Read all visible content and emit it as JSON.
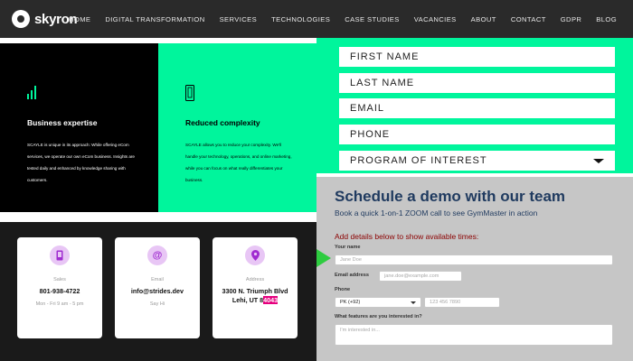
{
  "nav": {
    "logo_text": "skyron",
    "items": [
      "HOME",
      "DIGITAL TRANSFORMATION",
      "SERVICES",
      "TECHNOLOGIES",
      "CASE STUDIES",
      "VACANCIES",
      "ABOUT",
      "CONTACT",
      "GDPR",
      "BLOG"
    ]
  },
  "features": [
    {
      "icon": "bar-chart-icon",
      "title": "Business expertise",
      "body": "SCAYLE is unique in its approach: While offering eCom services, we operate our own eCom business. Insights are tested daily and enhanced by knowledge sharing with customers."
    },
    {
      "icon": "phone-outline-icon",
      "title": "Reduced complexity",
      "body": "SCAYLE allows you to reduce your complexity. We'll handle your technology, operations, and online marketing, while you can focus on what really differentiates your business."
    }
  ],
  "contact_cards": [
    {
      "icon": "phone-icon",
      "label": "Sales",
      "value": "801-938-4722",
      "sub": "Mon - Fri 9 am - 5 pm"
    },
    {
      "icon": "at-icon",
      "label": "Email",
      "value": "info@strides.dev",
      "sub": "Say Hi"
    },
    {
      "icon": "location-pin-icon",
      "label": "Address",
      "value_line1": "3300 N. Triumph Blvd",
      "value_line2_pre": "Lehi, UT 8",
      "value_line2_hl": "4043",
      "sub": ""
    }
  ],
  "green_form": {
    "fields": [
      "FIRST NAME",
      "LAST NAME",
      "EMAIL",
      "PHONE",
      "PROGRAM OF INTEREST"
    ]
  },
  "demo": {
    "title": "Schedule a demo with our team",
    "subtitle": "Book a quick 1-on-1 ZOOM call to see GymMaster in action",
    "add_details": "Add details below to show available times:",
    "name_label": "Your name",
    "name_placeholder": "Jane Doe",
    "email_label": "Email address",
    "email_placeholder": "jane.doe@example.com",
    "phone_label": "Phone",
    "country_value": "PK (+92)",
    "phone_placeholder": "123 456 7890",
    "features_label": "What features are you interested in?",
    "features_placeholder": "I'm interested in..."
  },
  "colors": {
    "nav_bg": "#2a2a2a",
    "accent_green": "#00f59c",
    "demo_title": "#1f3a5f",
    "demo_add": "#8b0000",
    "highlight": "#e6007e"
  }
}
